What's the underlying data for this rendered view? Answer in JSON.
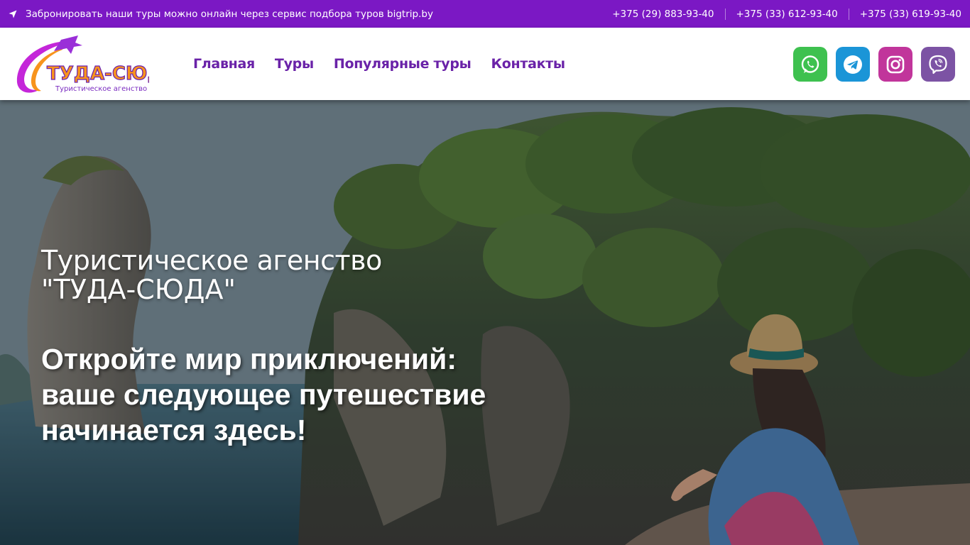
{
  "topbar": {
    "notice": "Забронировать наши туры можно онлайн через сервис подбора туров bigtrip.by",
    "phones": [
      "+375 (29) 883-93-40",
      "+375 (33) 612-93-40",
      "+375 (33) 619-93-40"
    ]
  },
  "header": {
    "logo": {
      "brand": "ТУДА-СЮДА",
      "tagline": "Туристическое агенство"
    },
    "nav": [
      {
        "label": "Главная"
      },
      {
        "label": "Туры"
      },
      {
        "label": "Популярные туры"
      },
      {
        "label": "Контакты"
      }
    ],
    "social": [
      {
        "name": "whatsapp-icon",
        "color": "#3ec14f"
      },
      {
        "name": "telegram-icon",
        "color": "#1b95d7"
      },
      {
        "name": "instagram-icon",
        "color": "#c1359b"
      },
      {
        "name": "viber-icon",
        "color": "#7c53a4"
      }
    ]
  },
  "hero": {
    "subtitle": "Туристическое агенство",
    "agency_name": "\"ТУДА-СЮДА\"",
    "headline_lines": [
      "Откройте мир приключений:",
      "ваше следующее путешествие",
      "начинается здесь!"
    ]
  },
  "colors": {
    "brand_purple": "#7b18c4",
    "nav_text": "#6a22a8",
    "logo_orange": "#f7941d"
  }
}
